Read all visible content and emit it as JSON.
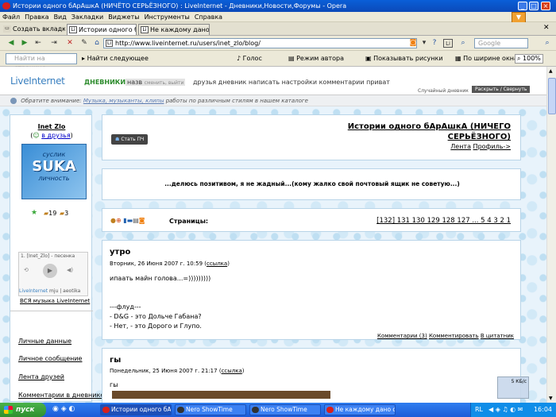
{
  "window": {
    "title": "Истории одного бАрАшкА (НИЧЁТО СЕРЬЁЗНОГО) : LiveInternet - Дневники,Новости,Форумы - Opera"
  },
  "menu": [
    "Файл",
    "Правка",
    "Вид",
    "Закладки",
    "Виджеты",
    "Инструменты",
    "Справка"
  ],
  "tabs": {
    "create": "Создать вкладку",
    "items": [
      "Истории одного бАр...",
      "Не каждому дано сл..."
    ]
  },
  "address": {
    "url": "http://www.liveinternet.ru/users/inet_zlo/blog/",
    "search_placeholder": "Google",
    "li_badge": "Li"
  },
  "findbar": {
    "placeholder": "Найти на странице",
    "find_next": "Найти следующее",
    "voice": "Голос",
    "author_mode": "Режим автора",
    "show_images": "Показывать рисунки",
    "fit_width": "По ширине окна",
    "zoom": "100%"
  },
  "site": {
    "logo": "LiveInternet",
    "nav_diaries": "ДНЕВНИКИ",
    "nav_names": "назв",
    "nav_change": "сменить, выйти",
    "nav_links": "друзья дневник написать настройки комментарии приват",
    "random": "Случайный дневник",
    "expand": "Раскрыть / Свернуть",
    "notice_label": "Обратите внимание:",
    "notice_link": "Музыка, музыканты, клипы",
    "notice_rest": "работы по различным стилям в нашем каталоге"
  },
  "profile": {
    "name": "Inet Zlo",
    "friends": "в друзья",
    "avatar_top": "суслик",
    "avatar_mid": "SUKA",
    "avatar_bot": "личность",
    "count1": "19",
    "count2": "3"
  },
  "player": {
    "title": "1. [Inet_Zlo] - песенка",
    "brand": "LiveInternet",
    "brand2": "mju | aeotika",
    "all_music": "ВСЯ музыка LiveInternet"
  },
  "sidebar": [
    "Личные данные",
    "Личное сообщение",
    "Лента друзей",
    "Комментарии в дневнике"
  ],
  "blog": {
    "become_pch": "Стать ПЧ",
    "title": "Истории одного бАрАшкА (НИЧЕГО СЕРЬЁЗНОГО)",
    "lenta": "Лента",
    "profile": "Профиль->",
    "motto": "...делюсь позитивом, я не жадный...(кому жалко свой почтовый ящик не советую...)",
    "pages_label": "Страницы:",
    "pages": "[132] 131 130 129 128 127 ... 5 4 3 2 1"
  },
  "posts": [
    {
      "title": "утро",
      "meta": "Вторник, 26 Июня 2007 г. 10:59 (",
      "link": "ссылка",
      "meta_end": ")",
      "lines": [
        "ипаать майн голова...=)))))))))",
        "",
        "",
        "---флуд---",
        "- D&G - это Дольче Габана?",
        "- Нет, - это Дорого и Глупо."
      ],
      "comments": "Комментарии (3)",
      "comment": "Комментировать",
      "quote": "В цитатник"
    },
    {
      "title": "гы",
      "meta": "Понедельник, 25 Июня 2007 г. 21:17 (",
      "link": "ссылка",
      "meta_end": ")",
      "lines": [
        "гы"
      ]
    }
  ],
  "taskbar": {
    "start": "пуск",
    "items": [
      "Истории одного бАр...",
      "Nero ShowTime",
      "Nero ShowTime",
      "Не каждому дано сл..."
    ],
    "lang": "RL",
    "time": "16:04",
    "speed": "5 КБ/с"
  }
}
